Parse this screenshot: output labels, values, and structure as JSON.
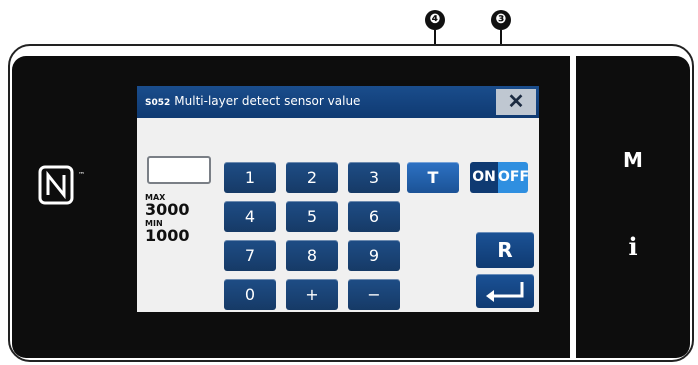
{
  "callouts": {
    "t_button": "❹",
    "onoff_button": "❸"
  },
  "dialog": {
    "code": "S052",
    "title": "Multi-layer detect sensor value",
    "close_glyph": "✕"
  },
  "value_display": {
    "value": ""
  },
  "limits": {
    "max_label": "MAX",
    "max_value": "3000",
    "min_label": "MIN",
    "min_value": "1000"
  },
  "keypad": {
    "k1": "1",
    "k2": "2",
    "k3": "3",
    "k4": "4",
    "k5": "5",
    "k6": "6",
    "k7": "7",
    "k8": "8",
    "k9": "9",
    "k0": "0",
    "plus": "+",
    "minus": "−"
  },
  "buttons": {
    "t_label": "T",
    "on_label": "ON",
    "off_label": "OFF",
    "r_label": "R",
    "enter_icon": "enter-icon"
  },
  "side_panel": {
    "m_label": "M",
    "info_label": "i"
  },
  "colors": {
    "accent": "#1b5296",
    "onoff_off": "#2f8fe0",
    "callout_dot": "#e8112d"
  }
}
